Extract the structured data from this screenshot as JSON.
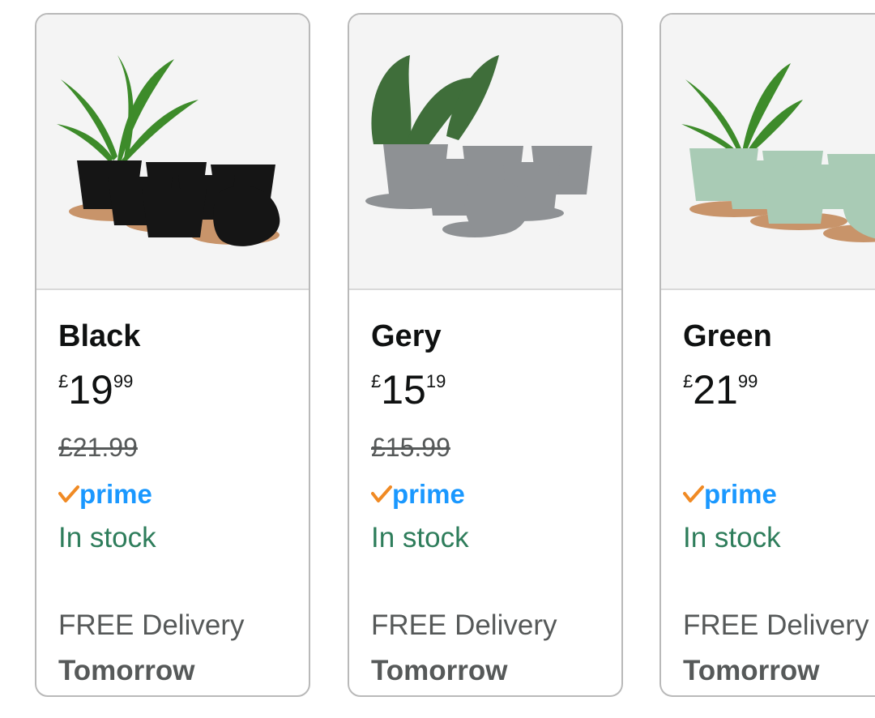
{
  "products": [
    {
      "color_name": "Black",
      "currency": "£",
      "price_whole": "19",
      "price_fraction": "99",
      "was_price": "£21.99",
      "badge": "prime",
      "availability": "In stock",
      "delivery": "FREE Delivery",
      "delivery_day": "Tomorrow",
      "pot_color": "#151515",
      "image_alt": "black plant pots"
    },
    {
      "color_name": "Gery",
      "currency": "£",
      "price_whole": "15",
      "price_fraction": "19",
      "was_price": "£15.99",
      "badge": "prime",
      "availability": "In stock",
      "delivery": "FREE Delivery",
      "delivery_day": "Tomorrow",
      "pot_color": "#8e9194",
      "image_alt": "grey plant pots"
    },
    {
      "color_name": "Green",
      "currency": "£",
      "price_whole": "21",
      "price_fraction": "99",
      "was_price": "",
      "badge": "prime",
      "availability": "In stock",
      "delivery": "FREE Delivery",
      "delivery_day": "Tomorrow",
      "pot_color": "#a9cbb5",
      "image_alt": "green plant pots"
    }
  ],
  "colors": {
    "prime_blue": "#1a98ff",
    "prime_check": "#f08a24",
    "in_stock": "#2e7d5b",
    "muted_text": "#565959"
  }
}
